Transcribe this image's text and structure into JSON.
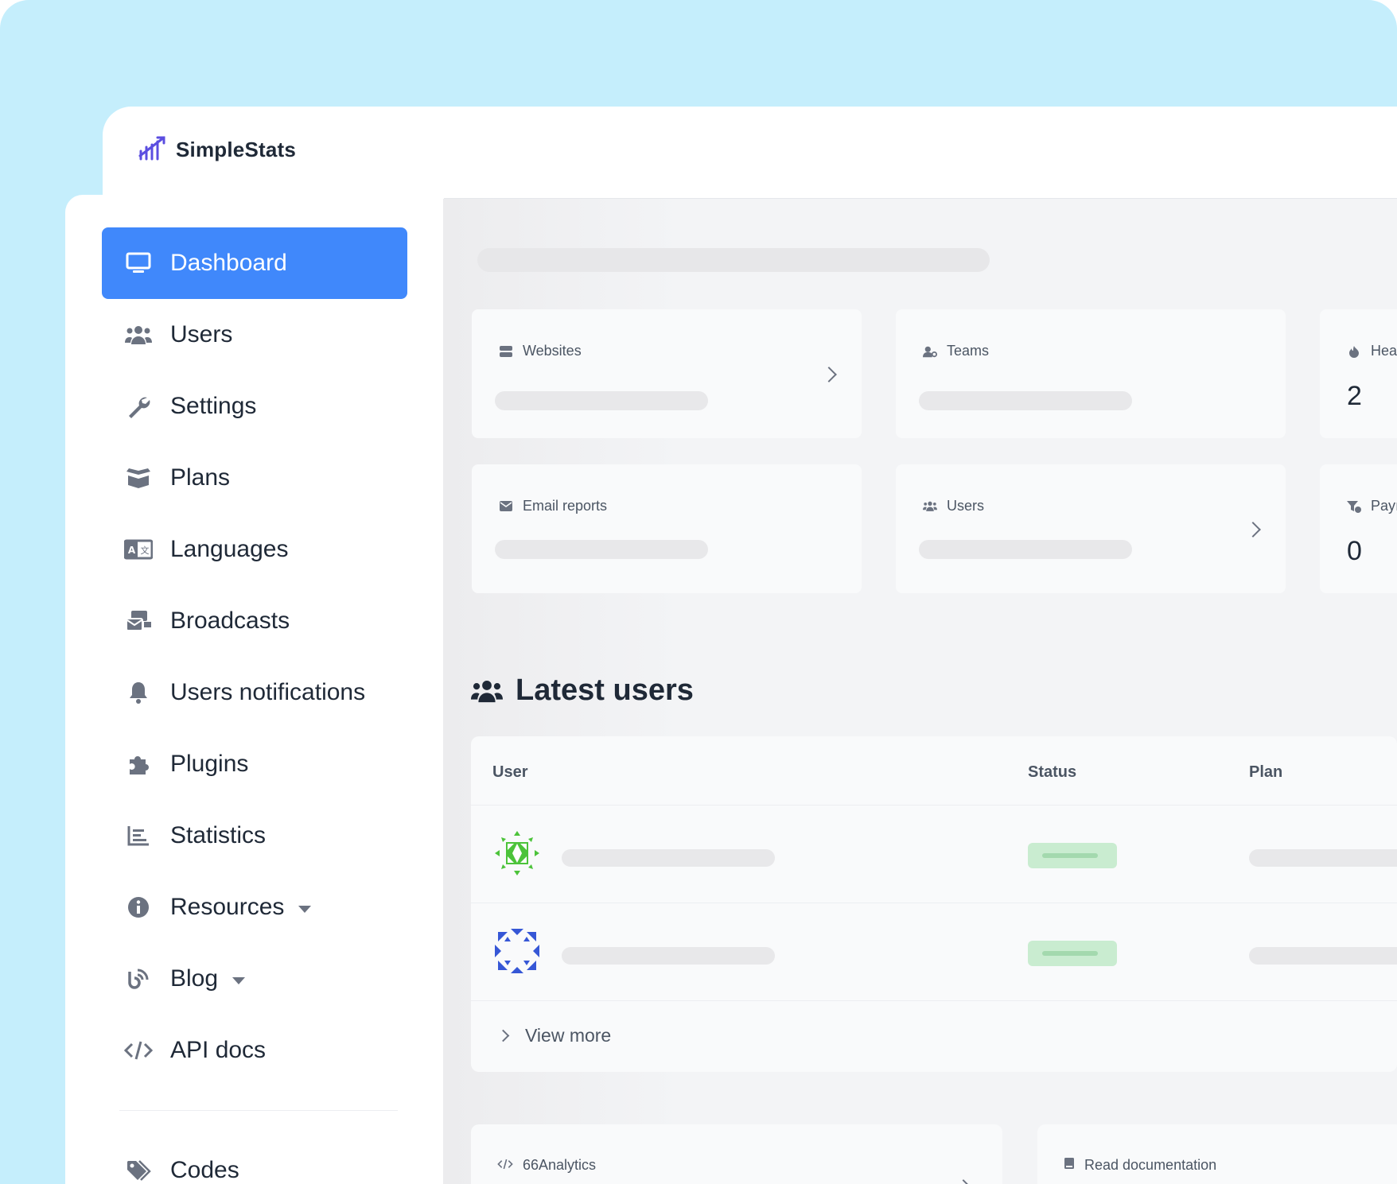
{
  "app": {
    "name": "SimpleStats"
  },
  "sidebar": {
    "items": [
      {
        "label": "Dashboard",
        "icon": "monitor-icon",
        "active": true
      },
      {
        "label": "Users",
        "icon": "users-icon"
      },
      {
        "label": "Settings",
        "icon": "wrench-icon"
      },
      {
        "label": "Plans",
        "icon": "box-open-icon"
      },
      {
        "label": "Languages",
        "icon": "language-icon"
      },
      {
        "label": "Broadcasts",
        "icon": "mail-bulk-icon"
      },
      {
        "label": "Users notifications",
        "icon": "bell-icon"
      },
      {
        "label": "Plugins",
        "icon": "puzzle-icon"
      },
      {
        "label": "Statistics",
        "icon": "chart-bar-icon"
      },
      {
        "label": "Resources",
        "icon": "info-icon",
        "dropdown": true
      },
      {
        "label": "Blog",
        "icon": "blog-icon",
        "dropdown": true
      },
      {
        "label": "API docs",
        "icon": "code-icon"
      }
    ],
    "codes_label": "Codes"
  },
  "stats": {
    "websites": {
      "label": "Websites"
    },
    "teams": {
      "label": "Teams"
    },
    "heartbeats": {
      "label": "Hea",
      "value": "2"
    },
    "email_reports": {
      "label": "Email reports"
    },
    "users": {
      "label": "Users"
    },
    "payments": {
      "label": "Payı",
      "value": "0"
    }
  },
  "latest_users": {
    "title": "Latest users",
    "columns": {
      "user": "User",
      "status": "Status",
      "plan": "Plan"
    },
    "view_more": "View more"
  },
  "bottom": {
    "analytics_label": "66Analytics",
    "docs_label": "Read documentation"
  },
  "colors": {
    "accent": "#4088fb",
    "background": "#c5eefc",
    "status_active": "#c9ecd0"
  }
}
